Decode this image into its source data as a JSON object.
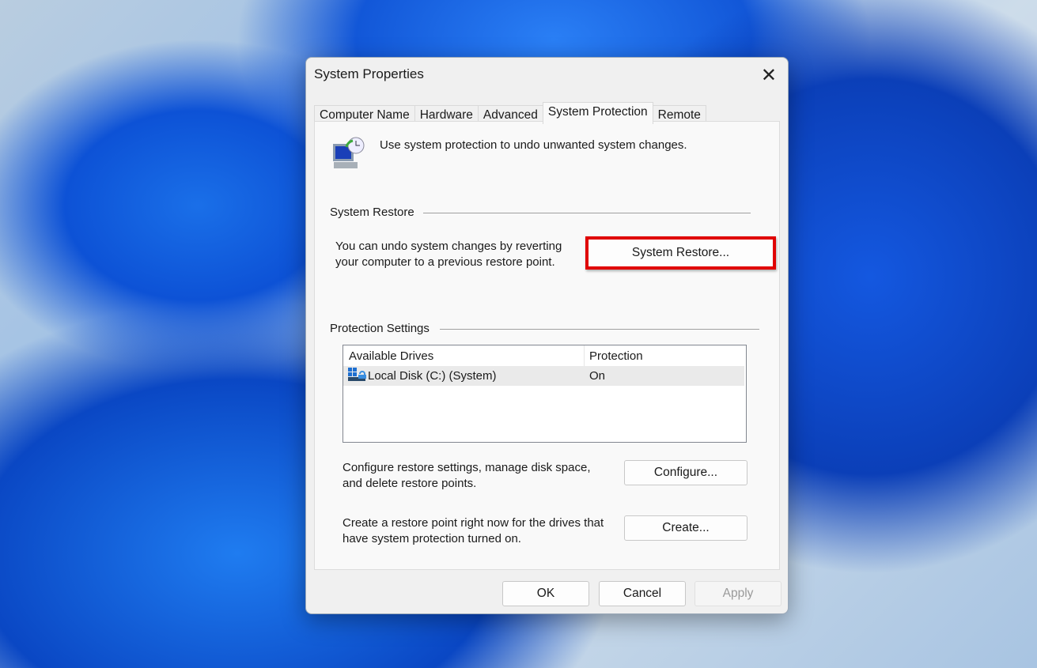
{
  "window": {
    "title": "System Properties",
    "close_icon": "close-icon"
  },
  "tabs": [
    {
      "label": "Computer Name"
    },
    {
      "label": "Hardware"
    },
    {
      "label": "Advanced"
    },
    {
      "label": "System Protection",
      "active": true
    },
    {
      "label": "Remote"
    }
  ],
  "intro": {
    "icon": "system-protection-icon",
    "text": "Use system protection to undo unwanted system changes."
  },
  "system_restore": {
    "heading": "System Restore",
    "line1": "You can undo system changes by reverting",
    "line2": "your computer to a previous restore point.",
    "button": "System Restore...",
    "highlight_color": "#e00000"
  },
  "protection": {
    "heading": "Protection Settings",
    "columns": [
      "Available Drives",
      "Protection"
    ],
    "rows": [
      {
        "drive": "Local Disk (C:) (System)",
        "protection": "On",
        "icon": "drive-icon"
      }
    ]
  },
  "configure": {
    "line1": "Configure restore settings, manage disk space,",
    "line2": "and delete restore points.",
    "button": "Configure..."
  },
  "create": {
    "line1": "Create a restore point right now for the drives that",
    "line2": "have system protection turned on.",
    "button": "Create..."
  },
  "footer": {
    "ok": "OK",
    "cancel": "Cancel",
    "apply": "Apply"
  }
}
